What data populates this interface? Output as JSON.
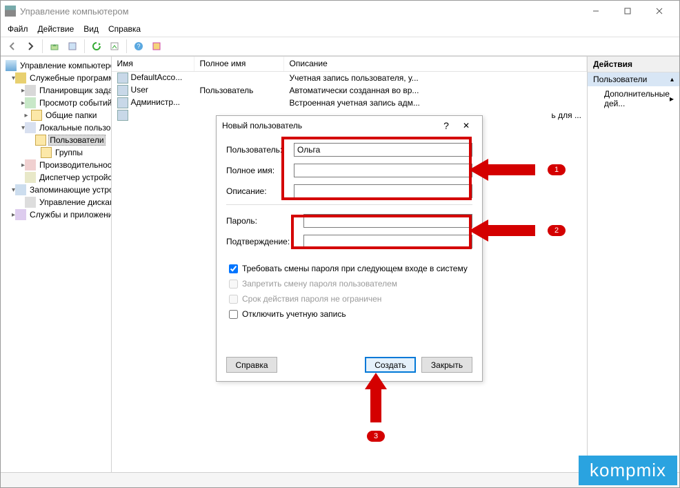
{
  "window": {
    "title": "Управление компьютером"
  },
  "win_controls": {
    "min": "–",
    "max": "☐",
    "close": "✕"
  },
  "menubar": [
    "Файл",
    "Действие",
    "Вид",
    "Справка"
  ],
  "tree": {
    "root": "Управление компьютером (локальным)",
    "n1": "Служебные программы",
    "n1a": "Планировщик заданий",
    "n1b": "Просмотр событий",
    "n1c": "Общие папки",
    "n1d": "Локальные пользователи и группы",
    "n1d1": "Пользователи",
    "n1d2": "Группы",
    "n1e": "Производительность",
    "n1f": "Диспетчер устройств",
    "n2": "Запоминающие устройства",
    "n2a": "Управление дисками",
    "n3": "Службы и приложения"
  },
  "list": {
    "headers": {
      "name": "Имя",
      "full": "Полное имя",
      "desc": "Описание"
    },
    "rows": [
      {
        "name": "DefaultAcco...",
        "full": "",
        "desc": "Учетная запись пользователя, у..."
      },
      {
        "name": "User",
        "full": "Пользователь",
        "desc": "Автоматически созданная во вр..."
      },
      {
        "name": "Администр...",
        "full": "",
        "desc": "Встроенная учетная запись адм..."
      },
      {
        "name": "",
        "full": "",
        "desc": "ь для ..."
      }
    ]
  },
  "actions": {
    "header": "Действия",
    "section": "Пользователи",
    "item1": "Дополнительные дей..."
  },
  "dialog": {
    "title": "Новый пользователь",
    "labels": {
      "user": "Пользователь:",
      "full": "Полное имя:",
      "desc": "Описание:",
      "pwd": "Пароль:",
      "confirm": "Подтверждение:"
    },
    "values": {
      "user": "Ольга",
      "full": "",
      "desc": "",
      "pwd": "",
      "confirm": ""
    },
    "checks": {
      "must_change": "Требовать смены пароля при следующем входе в систему",
      "no_change": "Запретить смену пароля пользователем",
      "never_expire": "Срок действия пароля не ограничен",
      "disable": "Отключить учетную запись"
    },
    "buttons": {
      "help": "Справка",
      "create": "Создать",
      "close": "Закрыть"
    }
  },
  "callouts": {
    "c1": "1",
    "c2": "2",
    "c3": "3"
  },
  "watermark": "kompmix"
}
